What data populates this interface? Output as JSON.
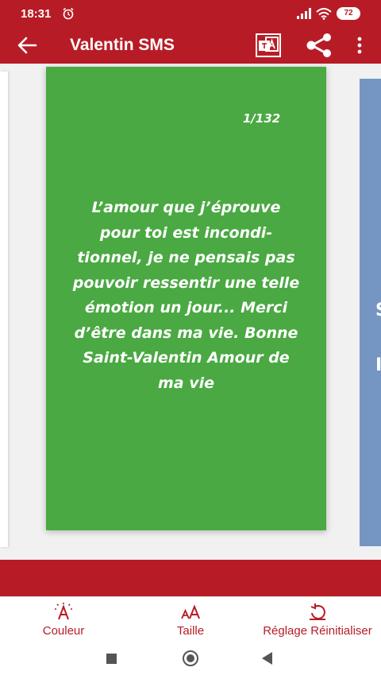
{
  "status_bar": {
    "time": "18:31",
    "battery": "72",
    "icons": [
      "alarm-icon",
      "signal-icon",
      "wifi-icon",
      "battery-icon"
    ]
  },
  "app_bar": {
    "title": "Valentin SMS",
    "color": "#b71c26",
    "actions": [
      "back-arrow-icon",
      "translate-icon",
      "share-icon",
      "more-vert-icon"
    ]
  },
  "card": {
    "counter": "1/132",
    "message": "L’amour que j’éprouve pour toi est incondi-tionnel, je ne pensais pas pouvoir ressentir une telle émotion un jour... Merci d’être dans ma vie. Bonne Saint-Valentin Amour de ma vie",
    "message_lines": [
      "L’amour que j’éprouve",
      "pour toi est incondi-",
      "tionnel, je ne pensais pas",
      "pouvoir ressentir une telle",
      "émotion un jour... Merci",
      "d’être dans ma vie. Bonne",
      "Saint-Valentin Amour de",
      "ma vie"
    ],
    "background": "#4aa942",
    "next_card_background": "#7596c2"
  },
  "toolbar": {
    "color_label": "Couleur",
    "size_label": "Taille",
    "reset_label": "Réglage Réinitialiser"
  },
  "nav": {
    "buttons": [
      "recents-icon",
      "home-icon",
      "back-icon"
    ]
  }
}
